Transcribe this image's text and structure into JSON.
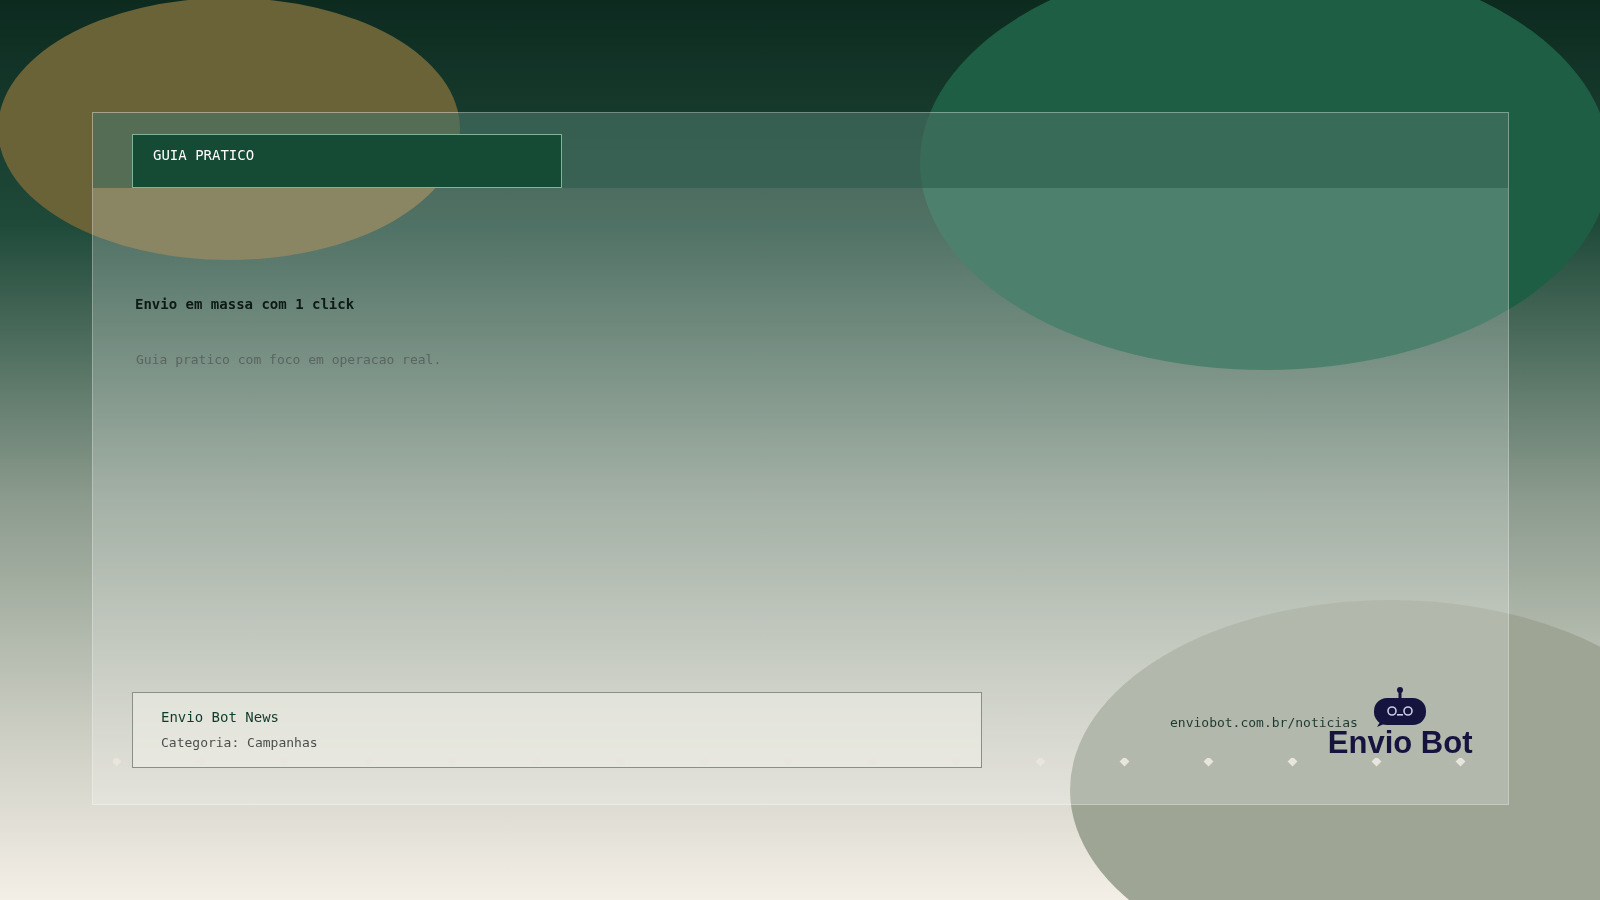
{
  "tag": "GUIA PRATICO",
  "title": "Envio em massa com 1 click",
  "subtitle": "Guia pratico com foco em operacao real.",
  "source": {
    "name": "Envio Bot News",
    "category": "Categoria: Campanhas"
  },
  "url": "enviobot.com.br/noticias",
  "brand": "Envio Bot"
}
